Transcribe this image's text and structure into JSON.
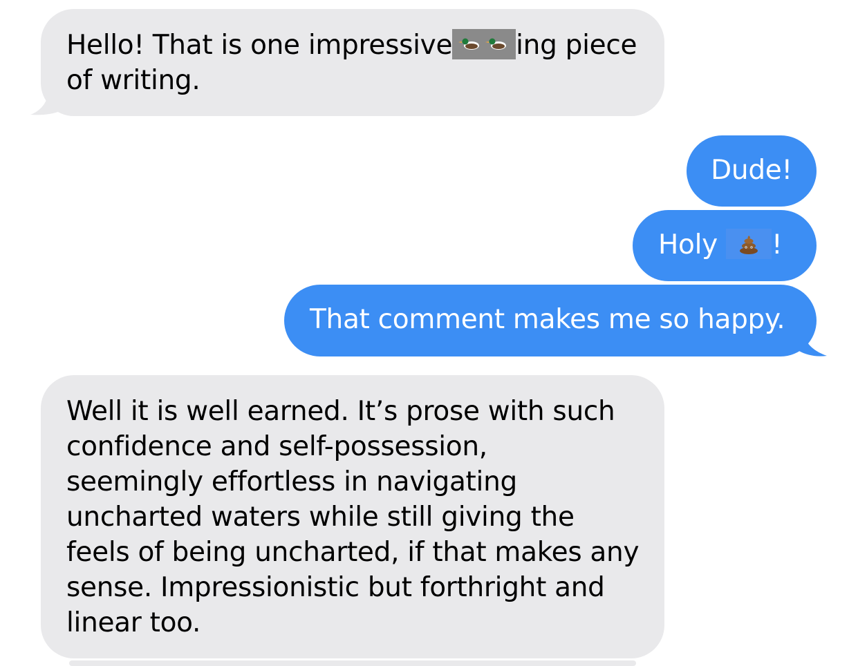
{
  "conversation": {
    "messages": [
      {
        "direction": "received",
        "lines": [
          {
            "before": "Hello! That is one impressive",
            "redacted": "duck-duck-emoji",
            "after": "ing piece"
          },
          {
            "text": "of writing."
          }
        ]
      },
      {
        "direction": "sent",
        "text": "Dude!"
      },
      {
        "direction": "sent",
        "before": "Holy ",
        "redacted": "poop-emoji",
        "after": "!"
      },
      {
        "direction": "sent",
        "text": "That comment makes me so happy."
      },
      {
        "direction": "received",
        "lines": [
          "Well it is well earned. It’s prose with such",
          "confidence and self-possession,",
          "seemingly effortless in navigating",
          "uncharted waters while still giving the",
          "feels of being uncharted, if that makes any",
          "sense. Impressionistic but forthright and",
          "linear too."
        ]
      }
    ]
  },
  "colors": {
    "received_bubble": "#e9e9eb",
    "sent_bubble": "#3c8ef4",
    "received_text": "#000000",
    "sent_text": "#ffffff",
    "redaction_gray": "#8a8a8a",
    "redaction_blue": "#4a90f0"
  }
}
